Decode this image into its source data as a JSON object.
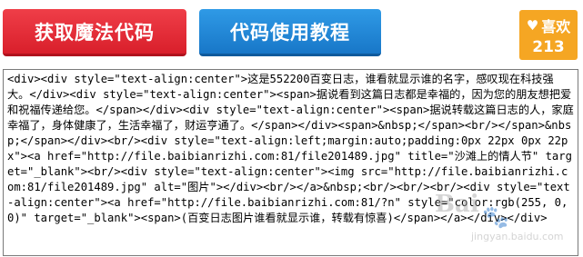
{
  "buttons": {
    "get_code": "获取魔法代码",
    "tutorial": "代码使用教程"
  },
  "like": {
    "label": "喜欢",
    "count": "213",
    "icon": "heart-icon"
  },
  "code_box": {
    "value": "<div><div style=\"text-align:center\">这是552200百变日志，谁看就显示谁的名字，感叹现在科技强大。</div><div style=\"text-align:center\"><span>据说看到这篇日志都是幸福的，因为您的朋友想把爱和祝福传递给您。</span></div><div style=\"text-align:center\"><span>据说转载这篇日志的人，家庭幸福了，身体健康了，生活幸福了，财运亨通了。</span></div><span>&nbsp;</span><br/></span>&nbsp;</span></div><br/><div style=\"text-align:left;margin:auto;padding:0px 22px 0px 22px\"><a href=\"http://file.baibianrizhi.com:81/file201489.jpg\" title=\"沙滩上的情人节\" target=\"_blank\"><br/><div style=\"text-align:center\"><img src=\"http://file.baibianrizhi.com:81/file201489.jpg\" alt=\"图片\"></div><br/></a>&nbsp;<br/><br/><br/><div style=\"text-align:center\"><a href=\"http://file.baibianrizhi.com:81/?n\" style=\"color:rgb(255, 0, 0)\" target=\"_blank\"><span>(百变日志图片谁看就显示谁，转载有惊喜)</span></a></div></div>"
  },
  "watermark": {
    "text": "Bai",
    "sub": "jingyan.baidu.com"
  },
  "colors": {
    "red_button": "#e02b36",
    "blue_button": "#2388d8",
    "like_badge": "#f5a623"
  }
}
